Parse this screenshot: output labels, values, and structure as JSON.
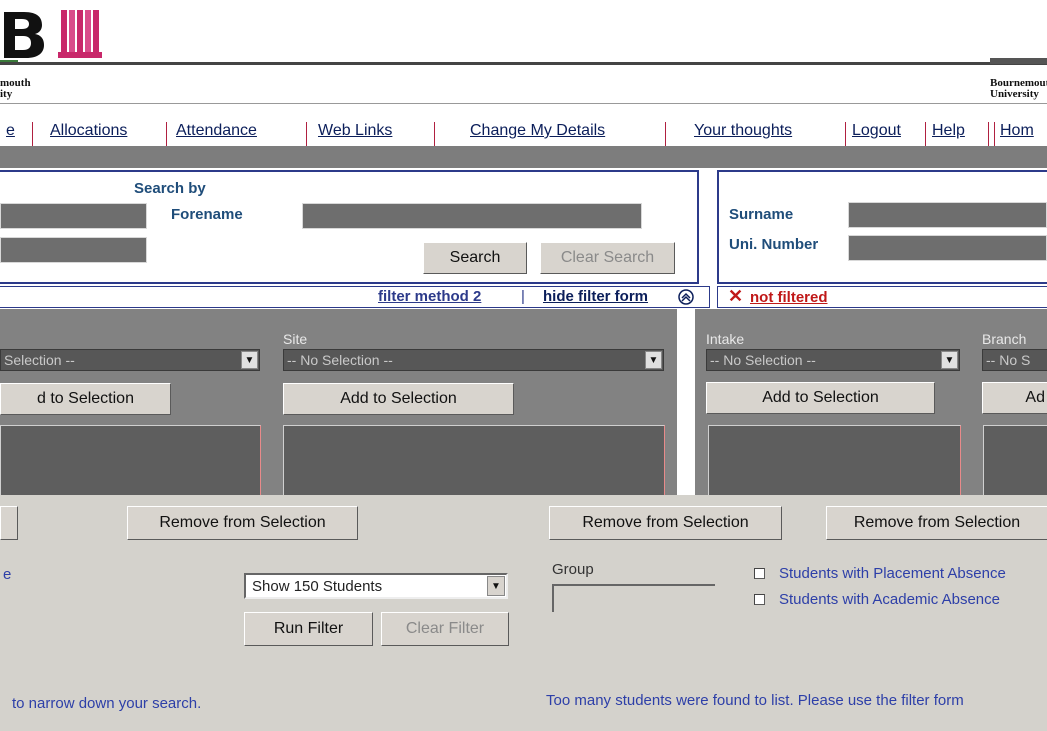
{
  "header": {
    "logo_text": "BU",
    "left_institution": "mouth\nity",
    "right_institution": "Bournemouth\nUniversity"
  },
  "nav": {
    "items": [
      {
        "label": "e"
      },
      {
        "label": "Allocations"
      },
      {
        "label": "Attendance"
      },
      {
        "label": "Web Links"
      },
      {
        "label": "Change My Details"
      },
      {
        "label": "Your thoughts"
      },
      {
        "label": "Logout"
      },
      {
        "label": "Help"
      },
      {
        "label": "Hom"
      }
    ]
  },
  "search": {
    "search_by_label": "Search by",
    "forename_label": "Forename",
    "surname_label": "Surname",
    "uni_number_label": "Uni. Number",
    "search_button": "Search",
    "clear_search_button": "Clear Search"
  },
  "filter_bar": {
    "method_link": "filter method 2",
    "separator": "|",
    "hide_link": "hide filter form",
    "status_text": "not filtered"
  },
  "filters": {
    "col1": {
      "select_value": "Selection --",
      "add_button": "d to Selection"
    },
    "site": {
      "label": "Site",
      "select_value": "-- No Selection --",
      "add_button": "Add to Selection",
      "remove_button": "Remove from Selection"
    },
    "intake": {
      "label": "Intake",
      "select_value": "-- No Selection --",
      "add_button": "Add to Selection",
      "remove_button": "Remove from Selection"
    },
    "branch": {
      "label": "Branch",
      "select_value": "-- No S",
      "add_button": "Ad",
      "remove_button": "Remove from Selection"
    }
  },
  "options": {
    "left_partial": "e",
    "show_select": "Show 150 Students",
    "run_filter": "Run Filter",
    "clear_filter": "Clear Filter",
    "group_label": "Group",
    "group_value": "",
    "checkbox_placement": "Students with Placement Absence",
    "checkbox_academic": "Students with Academic Absence"
  },
  "messages": {
    "left_message": "to narrow down your search.",
    "right_message": "Too many students were found to list. Please use the filter form"
  }
}
